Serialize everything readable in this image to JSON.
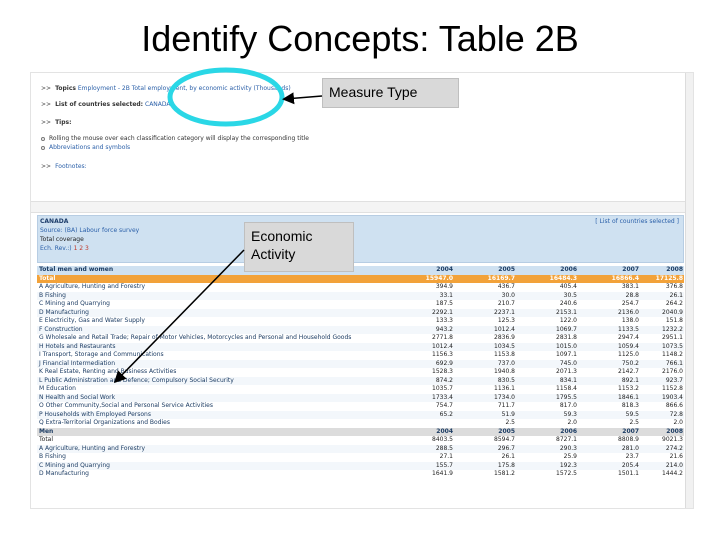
{
  "slide": {
    "title": "Identify Concepts: Table 2B"
  },
  "callouts": {
    "measure_type": "Measure Type",
    "economic_activity": "Economic\nActivity"
  },
  "nav": {
    "arrow": ">>",
    "topics_label": "Topics",
    "topics_value": "Employment - 2B Total employment, by economic activity (Thousands)",
    "countries_label": "List of countries selected:",
    "countries_value": "CANADA",
    "tips_label": "Tips:",
    "tip1": "Rolling the mouse over each classification category will display the corresponding title",
    "tip2": "Abbreviations and symbols",
    "footnotes_label": "Footnotes:"
  },
  "country_panel": {
    "country": "CANADA",
    "source": "Source: (BA) Labour force survey",
    "coverage": "Total coverage",
    "version_label": "Ech. Rev.:)",
    "version_nums": "1 2 3",
    "list_link": "[ List of countries selected ]"
  },
  "table": {
    "header_label": "Total men and women",
    "years": [
      "2004",
      "2005",
      "2006",
      "2007",
      "2008"
    ],
    "total_row": {
      "label": "Total",
      "values": [
        "15947.0",
        "16169.7",
        "16484.3",
        "16866.4",
        "17125.8"
      ]
    },
    "rows": [
      {
        "label": "A Agriculture, Hunting and Forestry",
        "values": [
          "394.9",
          "436.7",
          "405.4",
          "383.1",
          "376.8"
        ]
      },
      {
        "label": "B Fishing",
        "values": [
          "33.1",
          "30.0",
          "30.5",
          "28.8",
          "26.1"
        ]
      },
      {
        "label": "C Mining and Quarrying",
        "values": [
          "187.5",
          "210.7",
          "240.6",
          "254.7",
          "264.2"
        ]
      },
      {
        "label": "D Manufacturing",
        "values": [
          "2292.1",
          "2237.1",
          "2153.1",
          "2136.0",
          "2040.9"
        ]
      },
      {
        "label": "E Electricity, Gas and Water Supply",
        "values": [
          "133.3",
          "125.3",
          "122.0",
          "138.0",
          "151.8"
        ]
      },
      {
        "label": "F Construction",
        "values": [
          "943.2",
          "1012.4",
          "1069.7",
          "1133.5",
          "1232.2"
        ]
      },
      {
        "label": "G Wholesale and Retail Trade; Repair of Motor Vehicles, Motorcycles and Personal and Household Goods",
        "values": [
          "2771.8",
          "2836.9",
          "2831.8",
          "2947.4",
          "2951.1"
        ]
      },
      {
        "label": "H Hotels and Restaurants",
        "values": [
          "1012.4",
          "1034.5",
          "1015.0",
          "1059.4",
          "1073.5"
        ]
      },
      {
        "label": "I Transport, Storage and Communications",
        "values": [
          "1156.3",
          "1153.8",
          "1097.1",
          "1125.0",
          "1148.2"
        ]
      },
      {
        "label": "J Financial Intermediation",
        "values": [
          "692.9",
          "737.0",
          "745.0",
          "750.2",
          "766.1"
        ]
      },
      {
        "label": "K Real Estate, Renting and Business Activities",
        "values": [
          "1528.3",
          "1940.8",
          "2071.3",
          "2142.7",
          "2176.0"
        ]
      },
      {
        "label": "L Public Administration and Defence; Compulsory Social Security",
        "values": [
          "874.2",
          "830.5",
          "834.1",
          "892.1",
          "923.7"
        ]
      },
      {
        "label": "M Education",
        "values": [
          "1035.7",
          "1136.1",
          "1158.4",
          "1153.2",
          "1152.8"
        ]
      },
      {
        "label": "N Health and Social Work",
        "values": [
          "1733.4",
          "1734.0",
          "1795.5",
          "1846.1",
          "1903.4"
        ]
      },
      {
        "label": "O Other Community,Social and Personal Service Activities",
        "values": [
          "754.7",
          "711.7",
          "817.0",
          "818.3",
          "866.6"
        ]
      },
      {
        "label": "P Households with Employed Persons",
        "values": [
          "65.2",
          "51.9",
          "59.3",
          "59.5",
          "72.8"
        ]
      },
      {
        "label": "Q Extra-Territorial Organizations and Bodies",
        "values": [
          "",
          "2.5",
          "2.0",
          "2.5",
          "2.0"
        ]
      }
    ],
    "men_label": "Men",
    "men_years": [
      "2004",
      "2005",
      "2006",
      "2007",
      "2008"
    ],
    "men_rows": [
      {
        "label": "Total",
        "values": [
          "8403.5",
          "8594.7",
          "8727.1",
          "8808.9",
          "9021.3"
        ]
      },
      {
        "label": "A Agriculture, Hunting and Forestry",
        "values": [
          "288.5",
          "296.7",
          "290.3",
          "281.0",
          "274.2"
        ]
      },
      {
        "label": "B Fishing",
        "values": [
          "27.1",
          "26.1",
          "25.9",
          "23.7",
          "21.6"
        ]
      },
      {
        "label": "C Mining and Quarrying",
        "values": [
          "155.7",
          "175.8",
          "192.3",
          "205.4",
          "214.0"
        ]
      },
      {
        "label": "D Manufacturing",
        "values": [
          "1641.9",
          "1581.2",
          "1572.5",
          "1501.1",
          "1444.2"
        ]
      }
    ]
  }
}
